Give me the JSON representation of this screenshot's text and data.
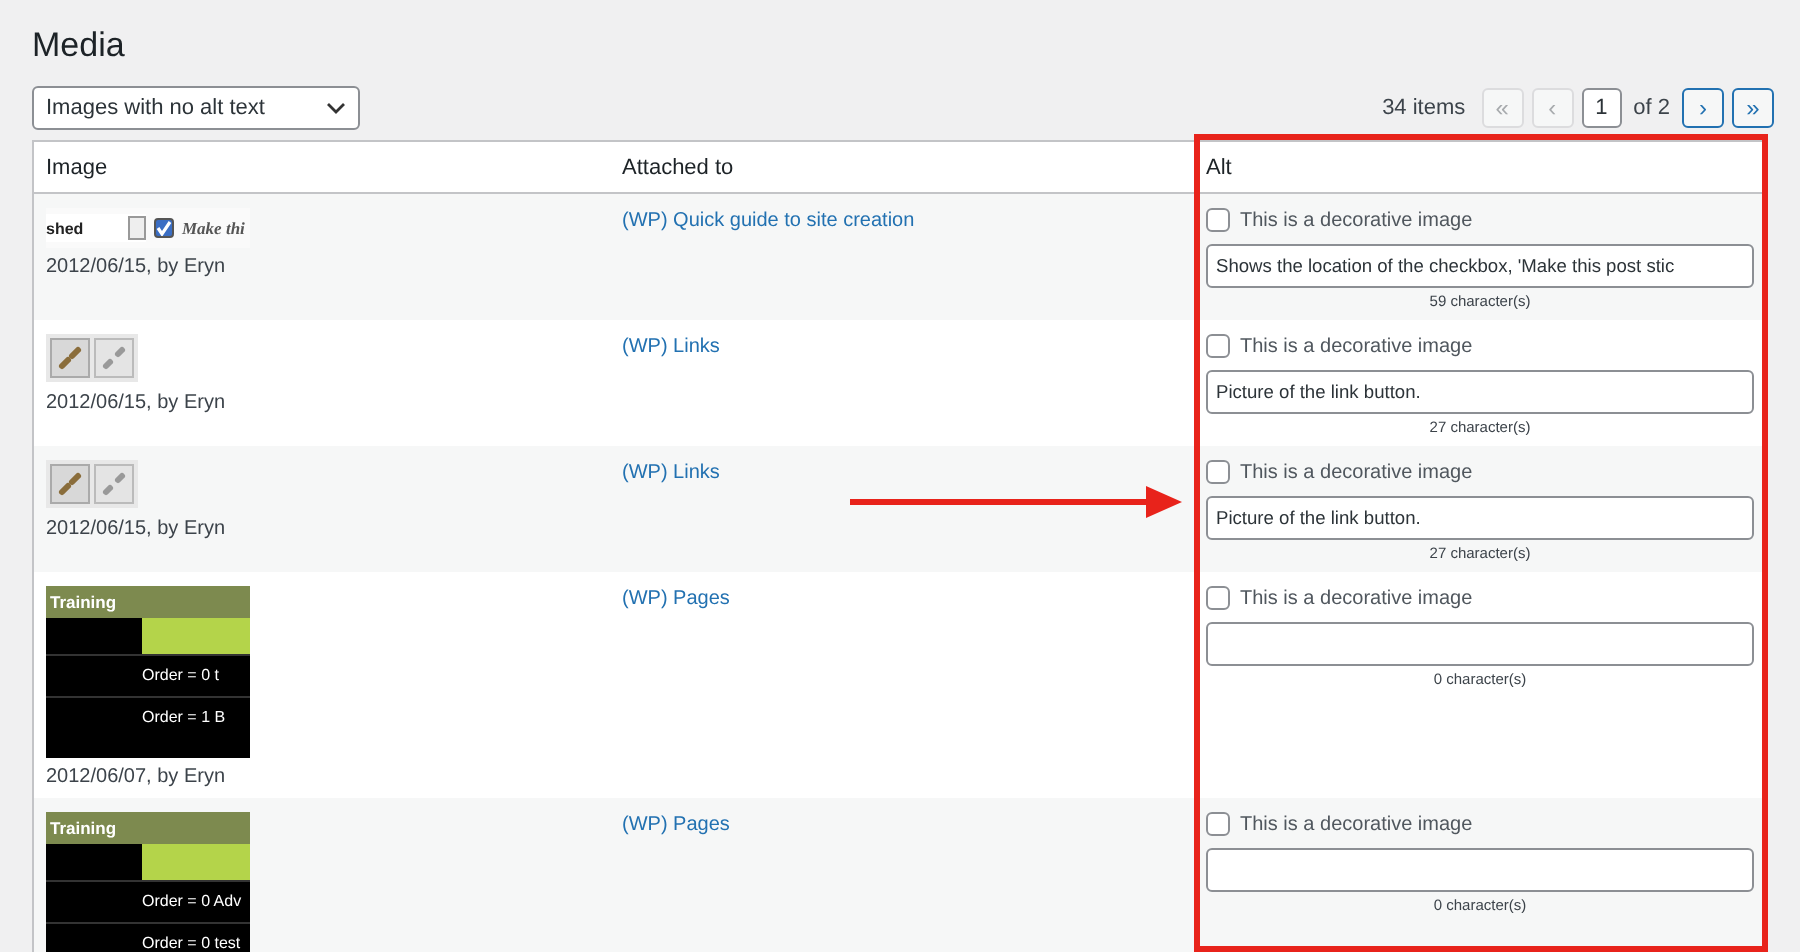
{
  "page": {
    "title": "Media"
  },
  "filter": {
    "value": "Images with no alt text"
  },
  "pagination": {
    "count": "34 items",
    "page": "1",
    "of": "of 2",
    "buttons": [
      {
        "label": "«",
        "disabled": true
      },
      {
        "label": "‹",
        "disabled": true
      },
      {
        "label": "›",
        "disabled": false
      },
      {
        "label": "»",
        "disabled": false
      }
    ]
  },
  "table": {
    "columns": [
      "Image",
      "Attached to",
      "Alt"
    ],
    "rows": [
      {
        "thumbnail": {
          "kind": "form",
          "texts": [
            "shed",
            "Make thi"
          ],
          "checked": true
        },
        "date": "2012/06/15, by Eryn",
        "attached": "(WP) Quick guide to site creation",
        "decorative": {
          "label": "This is a decorative image",
          "checked": false
        },
        "alt": "Shows the location of the checkbox, 'Make this post stic",
        "count": "59 character(s)"
      },
      {
        "thumbnail": {
          "kind": "buttons"
        },
        "date": "2012/06/15, by Eryn",
        "attached": "(WP) Links",
        "decorative": {
          "label": "This is a decorative image",
          "checked": false
        },
        "alt": "Picture of the link button.",
        "count": "27 character(s)"
      },
      {
        "thumbnail": {
          "kind": "buttons"
        },
        "date": "2012/06/15, by Eryn",
        "attached": "(WP) Links",
        "decorative": {
          "label": "This is a decorative image",
          "checked": false
        },
        "alt": "Picture of the link button.",
        "count": "27 character(s)"
      },
      {
        "thumbnail": {
          "kind": "menu",
          "texts": [
            "Training",
            "Order = 0 t",
            "Order = 1 B"
          ]
        },
        "date": "2012/06/07, by Eryn",
        "attached": "(WP) Pages",
        "decorative": {
          "label": "This is a decorative image",
          "checked": false
        },
        "alt": "",
        "count": "0 character(s)"
      },
      {
        "thumbnail": {
          "kind": "menu",
          "texts": [
            "Training",
            "Order = 0 Adv",
            "Order = 0 test"
          ]
        },
        "attached": "(WP) Pages",
        "decorative": {
          "label": "This is a decorative image",
          "checked": false
        },
        "alt": "",
        "count": "0 character(s)"
      }
    ]
  },
  "annotations": {
    "highlight_box": true,
    "arrow": true
  }
}
